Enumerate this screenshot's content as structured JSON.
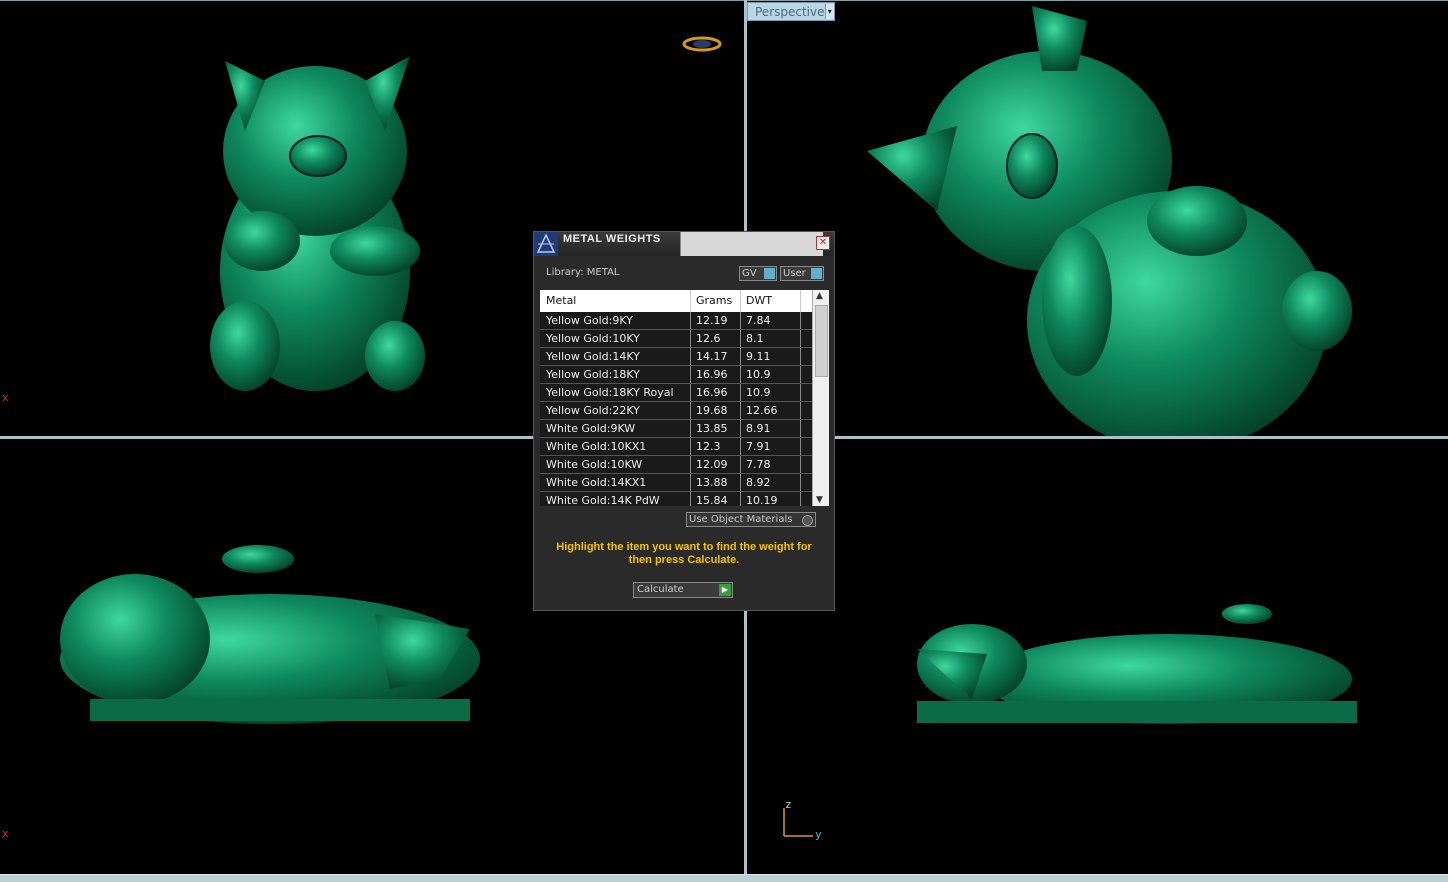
{
  "viewport": {
    "perspective_label": "Perspective",
    "dropdown_glyph": "▾",
    "axis_x_tl": "x",
    "axis_x_bl": "x",
    "axis_z": "z",
    "axis_y": "y",
    "model_color": "#0f8a60"
  },
  "dialog": {
    "title": "METAL WEIGHTS",
    "close_glyph": "✕",
    "library_label": "Library: METAL",
    "gv_label": "GV",
    "user_label": "User",
    "columns": [
      "Metal",
      "Grams",
      "DWT"
    ],
    "rows": [
      [
        "Yellow Gold:9KY",
        "12.19",
        "7.84"
      ],
      [
        "Yellow Gold:10KY",
        "12.6",
        "8.1"
      ],
      [
        "Yellow Gold:14KY",
        "14.17",
        "9.11"
      ],
      [
        "Yellow Gold:18KY",
        "16.96",
        "10.9"
      ],
      [
        "Yellow Gold:18KY Royal",
        "16.96",
        "10.9"
      ],
      [
        "Yellow Gold:22KY",
        "19.68",
        "12.66"
      ],
      [
        "White Gold:9KW",
        "13.85",
        "8.91"
      ],
      [
        "White Gold:10KX1",
        "12.3",
        "7.91"
      ],
      [
        "White Gold:10KW",
        "12.09",
        "7.78"
      ],
      [
        "White Gold:14KX1",
        "13.88",
        "8.92"
      ],
      [
        "White Gold:14K PdW",
        "15.84",
        "10.19"
      ]
    ],
    "scroll_up": "▲",
    "scroll_down": "▼",
    "use_object_materials": "Use Object Materials",
    "hint": "Highlight the item you want to find the weight for then press Calculate.",
    "calculate_label": "Calculate",
    "calculate_glyph": "▶",
    "hint_color": "#f2c400"
  }
}
